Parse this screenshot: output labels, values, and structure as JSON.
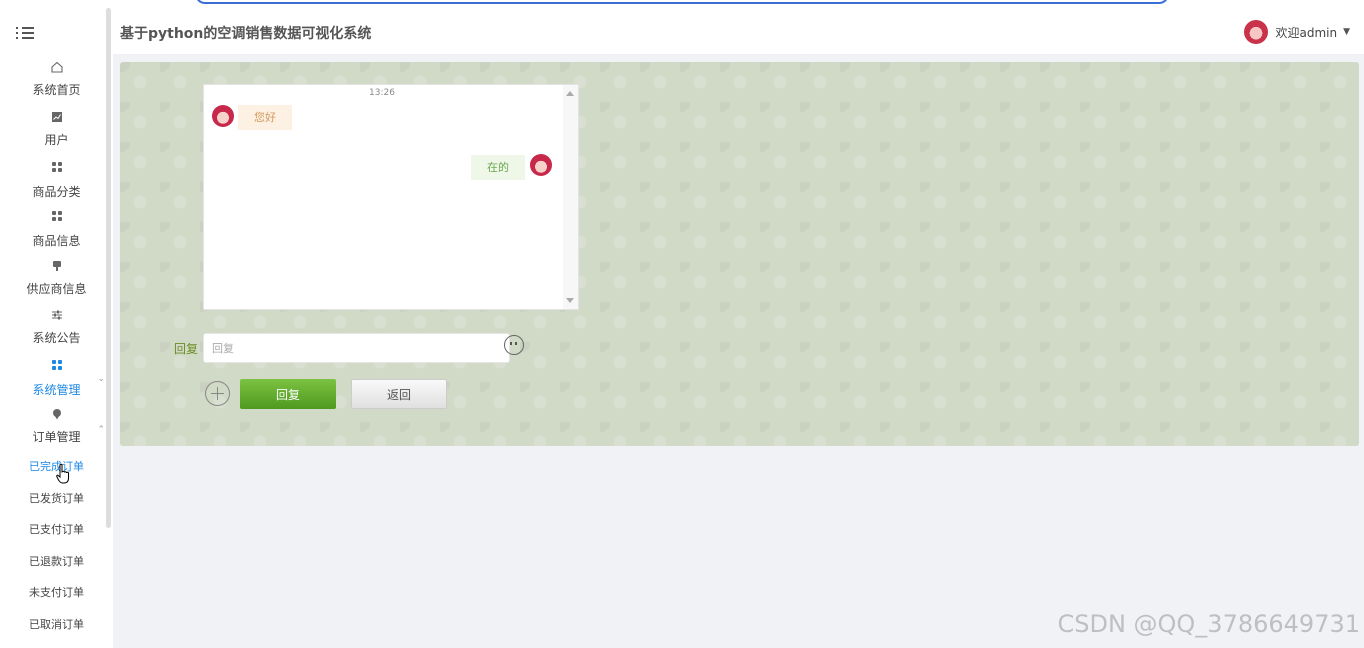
{
  "header": {
    "title": "基于python的空调销售数据可视化系统",
    "welcome": "欢迎admin"
  },
  "sidebar": {
    "items": [
      {
        "label": "系统首页",
        "icon": "home-icon"
      },
      {
        "label": "用户",
        "icon": "chart-icon"
      },
      {
        "label": "商品分类",
        "icon": "grid-icon"
      },
      {
        "label": "商品信息",
        "icon": "grid-icon"
      },
      {
        "label": "供应商信息",
        "icon": "plug-icon"
      },
      {
        "label": "系统公告",
        "icon": "sliders-icon"
      },
      {
        "label": "系统管理",
        "icon": "grid-icon",
        "active": true
      },
      {
        "label": "订单管理",
        "icon": "pin-icon"
      }
    ],
    "order_subitems": [
      "已完成订单",
      "已发货订单",
      "已支付订单",
      "已退款订单",
      "未支付订单",
      "已取消订单"
    ]
  },
  "chat": {
    "time": "13:26",
    "messages": [
      {
        "side": "left",
        "text": "您好"
      },
      {
        "side": "right",
        "text": "在的"
      }
    ]
  },
  "reply": {
    "label": "回复",
    "placeholder": "回复",
    "submit_label": "回复",
    "back_label": "返回"
  },
  "watermark": "CSDN @QQ_3786649731",
  "colors": {
    "accent_blue": "#1e88e5",
    "button_green": "#5fab2a",
    "panel_bg": "#d1d9c7"
  }
}
